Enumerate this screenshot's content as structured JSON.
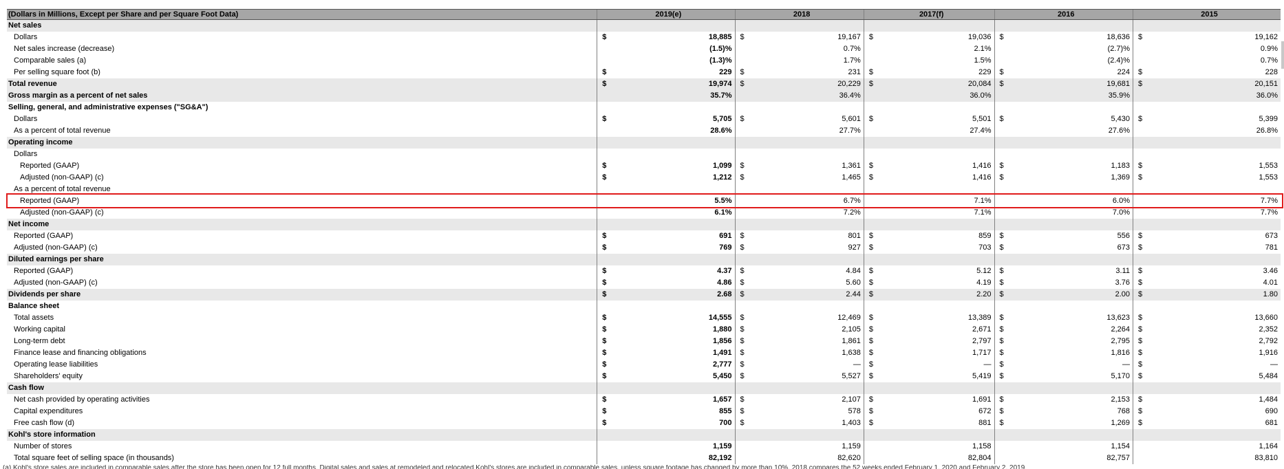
{
  "table": {
    "header": {
      "description": "(Dollars in Millions, Except per Share and per Square Foot Data)",
      "columns": [
        "2019(e)",
        "2018",
        "2017(f)",
        "2016",
        "2015"
      ]
    },
    "rows": [
      {
        "label": "Net sales",
        "indent": 0,
        "bold": true,
        "shaded": true,
        "values": []
      },
      {
        "label": "Dollars",
        "indent": 1,
        "bold": false,
        "shaded": false,
        "values": [
          {
            "cur": "$",
            "v": "18,885"
          },
          {
            "cur": "$",
            "v": "19,167"
          },
          {
            "cur": "$",
            "v": "19,036"
          },
          {
            "cur": "$",
            "v": "18,636"
          },
          {
            "cur": "$",
            "v": "19,162"
          }
        ]
      },
      {
        "label": "Net sales increase (decrease)",
        "indent": 1,
        "bold": false,
        "shaded": false,
        "values": [
          {
            "cur": "",
            "v": "(1.5)%"
          },
          {
            "cur": "",
            "v": "0.7%"
          },
          {
            "cur": "",
            "v": "2.1%"
          },
          {
            "cur": "",
            "v": "(2.7)%"
          },
          {
            "cur": "",
            "v": "0.9%"
          }
        ]
      },
      {
        "label": "Comparable sales (a)",
        "indent": 1,
        "bold": false,
        "shaded": false,
        "values": [
          {
            "cur": "",
            "v": "(1.3)%"
          },
          {
            "cur": "",
            "v": "1.7%"
          },
          {
            "cur": "",
            "v": "1.5%"
          },
          {
            "cur": "",
            "v": "(2.4)%"
          },
          {
            "cur": "",
            "v": "0.7%"
          }
        ]
      },
      {
        "label": "Per selling square foot (b)",
        "indent": 1,
        "bold": false,
        "shaded": false,
        "values": [
          {
            "cur": "$",
            "v": "229"
          },
          {
            "cur": "$",
            "v": "231"
          },
          {
            "cur": "$",
            "v": "229"
          },
          {
            "cur": "$",
            "v": "224"
          },
          {
            "cur": "$",
            "v": "228"
          }
        ]
      },
      {
        "label": "Total revenue",
        "indent": 0,
        "bold": true,
        "shaded": true,
        "values": [
          {
            "cur": "$",
            "v": "19,974"
          },
          {
            "cur": "$",
            "v": "20,229"
          },
          {
            "cur": "$",
            "v": "20,084"
          },
          {
            "cur": "$",
            "v": "19,681"
          },
          {
            "cur": "$",
            "v": "20,151"
          }
        ]
      },
      {
        "label": "Gross margin as a percent of net sales",
        "indent": 0,
        "bold": true,
        "shaded": true,
        "values": [
          {
            "cur": "",
            "v": "35.7%"
          },
          {
            "cur": "",
            "v": "36.4%"
          },
          {
            "cur": "",
            "v": "36.0%"
          },
          {
            "cur": "",
            "v": "35.9%"
          },
          {
            "cur": "",
            "v": "36.0%"
          }
        ]
      },
      {
        "label": "Selling, general, and administrative expenses (\"SG&A\")",
        "indent": 0,
        "bold": true,
        "shaded": false,
        "values": []
      },
      {
        "label": "Dollars",
        "indent": 1,
        "bold": false,
        "shaded": false,
        "values": [
          {
            "cur": "$",
            "v": "5,705"
          },
          {
            "cur": "$",
            "v": "5,601"
          },
          {
            "cur": "$",
            "v": "5,501"
          },
          {
            "cur": "$",
            "v": "5,430"
          },
          {
            "cur": "$",
            "v": "5,399"
          }
        ]
      },
      {
        "label": "As a percent of total revenue",
        "indent": 1,
        "bold": false,
        "shaded": false,
        "values": [
          {
            "cur": "",
            "v": "28.6%"
          },
          {
            "cur": "",
            "v": "27.7%"
          },
          {
            "cur": "",
            "v": "27.4%"
          },
          {
            "cur": "",
            "v": "27.6%"
          },
          {
            "cur": "",
            "v": "26.8%"
          }
        ]
      },
      {
        "label": "Operating income",
        "indent": 0,
        "bold": true,
        "shaded": true,
        "values": []
      },
      {
        "label": "Dollars",
        "indent": 1,
        "bold": false,
        "shaded": false,
        "values": []
      },
      {
        "label": "Reported (GAAP)",
        "indent": 2,
        "bold": false,
        "shaded": false,
        "values": [
          {
            "cur": "$",
            "v": "1,099"
          },
          {
            "cur": "$",
            "v": "1,361"
          },
          {
            "cur": "$",
            "v": "1,416"
          },
          {
            "cur": "$",
            "v": "1,183"
          },
          {
            "cur": "$",
            "v": "1,553"
          }
        ]
      },
      {
        "label": "Adjusted (non-GAAP) (c)",
        "indent": 2,
        "bold": false,
        "shaded": false,
        "values": [
          {
            "cur": "$",
            "v": "1,212"
          },
          {
            "cur": "$",
            "v": "1,465"
          },
          {
            "cur": "$",
            "v": "1,416"
          },
          {
            "cur": "$",
            "v": "1,369"
          },
          {
            "cur": "$",
            "v": "1,553"
          }
        ]
      },
      {
        "label": "As a percent of total revenue",
        "indent": 1,
        "bold": false,
        "shaded": false,
        "values": []
      },
      {
        "label": "Reported (GAAP)",
        "indent": 2,
        "bold": false,
        "shaded": false,
        "values": [
          {
            "cur": "",
            "v": "5.5%"
          },
          {
            "cur": "",
            "v": "6.7%"
          },
          {
            "cur": "",
            "v": "7.1%"
          },
          {
            "cur": "",
            "v": "6.0%"
          },
          {
            "cur": "",
            "v": "7.7%"
          }
        ]
      },
      {
        "label": "Adjusted (non-GAAP) (c)",
        "indent": 2,
        "bold": false,
        "shaded": false,
        "values": [
          {
            "cur": "",
            "v": "6.1%"
          },
          {
            "cur": "",
            "v": "7.2%"
          },
          {
            "cur": "",
            "v": "7.1%"
          },
          {
            "cur": "",
            "v": "7.0%"
          },
          {
            "cur": "",
            "v": "7.7%"
          }
        ]
      },
      {
        "label": "Net income",
        "indent": 0,
        "bold": true,
        "shaded": true,
        "values": []
      },
      {
        "label": "Reported (GAAP)",
        "indent": 1,
        "bold": false,
        "shaded": false,
        "highlighted": true,
        "values": [
          {
            "cur": "$",
            "v": "691"
          },
          {
            "cur": "$",
            "v": "801"
          },
          {
            "cur": "$",
            "v": "859"
          },
          {
            "cur": "$",
            "v": "556"
          },
          {
            "cur": "$",
            "v": "673"
          }
        ]
      },
      {
        "label": "Adjusted (non-GAAP) (c)",
        "indent": 1,
        "bold": false,
        "shaded": false,
        "values": [
          {
            "cur": "$",
            "v": "769"
          },
          {
            "cur": "$",
            "v": "927"
          },
          {
            "cur": "$",
            "v": "703"
          },
          {
            "cur": "$",
            "v": "673"
          },
          {
            "cur": "$",
            "v": "781"
          }
        ]
      },
      {
        "label": "Diluted earnings per share",
        "indent": 0,
        "bold": true,
        "shaded": true,
        "values": []
      },
      {
        "label": "Reported (GAAP)",
        "indent": 1,
        "bold": false,
        "shaded": false,
        "values": [
          {
            "cur": "$",
            "v": "4.37"
          },
          {
            "cur": "$",
            "v": "4.84"
          },
          {
            "cur": "$",
            "v": "5.12"
          },
          {
            "cur": "$",
            "v": "3.11"
          },
          {
            "cur": "$",
            "v": "3.46"
          }
        ]
      },
      {
        "label": "Adjusted (non-GAAP) (c)",
        "indent": 1,
        "bold": false,
        "shaded": false,
        "values": [
          {
            "cur": "$",
            "v": "4.86"
          },
          {
            "cur": "$",
            "v": "5.60"
          },
          {
            "cur": "$",
            "v": "4.19"
          },
          {
            "cur": "$",
            "v": "3.76"
          },
          {
            "cur": "$",
            "v": "4.01"
          }
        ]
      },
      {
        "label": "Dividends per share",
        "indent": 0,
        "bold": true,
        "shaded": true,
        "values": [
          {
            "cur": "$",
            "v": "2.68"
          },
          {
            "cur": "$",
            "v": "2.44"
          },
          {
            "cur": "$",
            "v": "2.20"
          },
          {
            "cur": "$",
            "v": "2.00"
          },
          {
            "cur": "$",
            "v": "1.80"
          }
        ]
      },
      {
        "label": "Balance sheet",
        "indent": 0,
        "bold": true,
        "shaded": false,
        "values": []
      },
      {
        "label": "Total assets",
        "indent": 1,
        "bold": false,
        "shaded": false,
        "values": [
          {
            "cur": "$",
            "v": "14,555"
          },
          {
            "cur": "$",
            "v": "12,469"
          },
          {
            "cur": "$",
            "v": "13,389"
          },
          {
            "cur": "$",
            "v": "13,623"
          },
          {
            "cur": "$",
            "v": "13,660"
          }
        ]
      },
      {
        "label": "Working capital",
        "indent": 1,
        "bold": false,
        "shaded": false,
        "values": [
          {
            "cur": "$",
            "v": "1,880"
          },
          {
            "cur": "$",
            "v": "2,105"
          },
          {
            "cur": "$",
            "v": "2,671"
          },
          {
            "cur": "$",
            "v": "2,264"
          },
          {
            "cur": "$",
            "v": "2,352"
          }
        ]
      },
      {
        "label": "Long-term debt",
        "indent": 1,
        "bold": false,
        "shaded": false,
        "values": [
          {
            "cur": "$",
            "v": "1,856"
          },
          {
            "cur": "$",
            "v": "1,861"
          },
          {
            "cur": "$",
            "v": "2,797"
          },
          {
            "cur": "$",
            "v": "2,795"
          },
          {
            "cur": "$",
            "v": "2,792"
          }
        ]
      },
      {
        "label": "Finance lease and financing obligations",
        "indent": 1,
        "bold": false,
        "shaded": false,
        "values": [
          {
            "cur": "$",
            "v": "1,491"
          },
          {
            "cur": "$",
            "v": "1,638"
          },
          {
            "cur": "$",
            "v": "1,717"
          },
          {
            "cur": "$",
            "v": "1,816"
          },
          {
            "cur": "$",
            "v": "1,916"
          }
        ]
      },
      {
        "label": "Operating lease liabilities",
        "indent": 1,
        "bold": false,
        "shaded": false,
        "values": [
          {
            "cur": "$",
            "v": "2,777"
          },
          {
            "cur": "$",
            "v": "—"
          },
          {
            "cur": "$",
            "v": "—"
          },
          {
            "cur": "$",
            "v": "—"
          },
          {
            "cur": "$",
            "v": "—"
          }
        ]
      },
      {
        "label": "Shareholders' equity",
        "indent": 1,
        "bold": false,
        "shaded": false,
        "values": [
          {
            "cur": "$",
            "v": "5,450"
          },
          {
            "cur": "$",
            "v": "5,527"
          },
          {
            "cur": "$",
            "v": "5,419"
          },
          {
            "cur": "$",
            "v": "5,170"
          },
          {
            "cur": "$",
            "v": "5,484"
          }
        ]
      },
      {
        "label": "Cash flow",
        "indent": 0,
        "bold": true,
        "shaded": true,
        "values": []
      },
      {
        "label": "Net cash provided by operating activities",
        "indent": 1,
        "bold": false,
        "shaded": false,
        "values": [
          {
            "cur": "$",
            "v": "1,657"
          },
          {
            "cur": "$",
            "v": "2,107"
          },
          {
            "cur": "$",
            "v": "1,691"
          },
          {
            "cur": "$",
            "v": "2,153"
          },
          {
            "cur": "$",
            "v": "1,484"
          }
        ]
      },
      {
        "label": "Capital expenditures",
        "indent": 1,
        "bold": false,
        "shaded": false,
        "values": [
          {
            "cur": "$",
            "v": "855"
          },
          {
            "cur": "$",
            "v": "578"
          },
          {
            "cur": "$",
            "v": "672"
          },
          {
            "cur": "$",
            "v": "768"
          },
          {
            "cur": "$",
            "v": "690"
          }
        ]
      },
      {
        "label": "Free cash flow (d)",
        "indent": 1,
        "bold": false,
        "shaded": false,
        "values": [
          {
            "cur": "$",
            "v": "700"
          },
          {
            "cur": "$",
            "v": "1,403"
          },
          {
            "cur": "$",
            "v": "881"
          },
          {
            "cur": "$",
            "v": "1,269"
          },
          {
            "cur": "$",
            "v": "681"
          }
        ]
      },
      {
        "label": "Kohl's store information",
        "indent": 0,
        "bold": true,
        "shaded": true,
        "values": []
      },
      {
        "label": "Number of stores",
        "indent": 1,
        "bold": false,
        "shaded": false,
        "values": [
          {
            "cur": "",
            "v": "1,159"
          },
          {
            "cur": "",
            "v": "1,159"
          },
          {
            "cur": "",
            "v": "1,158"
          },
          {
            "cur": "",
            "v": "1,154"
          },
          {
            "cur": "",
            "v": "1,164"
          }
        ]
      },
      {
        "label": "Total square feet of selling space (in thousands)",
        "indent": 1,
        "bold": false,
        "shaded": false,
        "values": [
          {
            "cur": "",
            "v": "82,192"
          },
          {
            "cur": "",
            "v": "82,620"
          },
          {
            "cur": "",
            "v": "82,804"
          },
          {
            "cur": "",
            "v": "82,757"
          },
          {
            "cur": "",
            "v": "83,810"
          }
        ]
      }
    ]
  },
  "colors": {
    "header_bg": "#a6a6a6",
    "section_bg": "#e8e8e8",
    "highlight_border": "#e01b1b"
  },
  "footnote": {
    "text": "(a)   Kohl's store sales are included in comparable sales after the store has been open for 12 full months. Digital sales and sales at remodeled and relocated Kohl's stores are included in comparable sales, unless square footage has changed by more than 10%. 2018 compares the 52 weeks ended February 1, 2020 and February 2, 2019."
  }
}
